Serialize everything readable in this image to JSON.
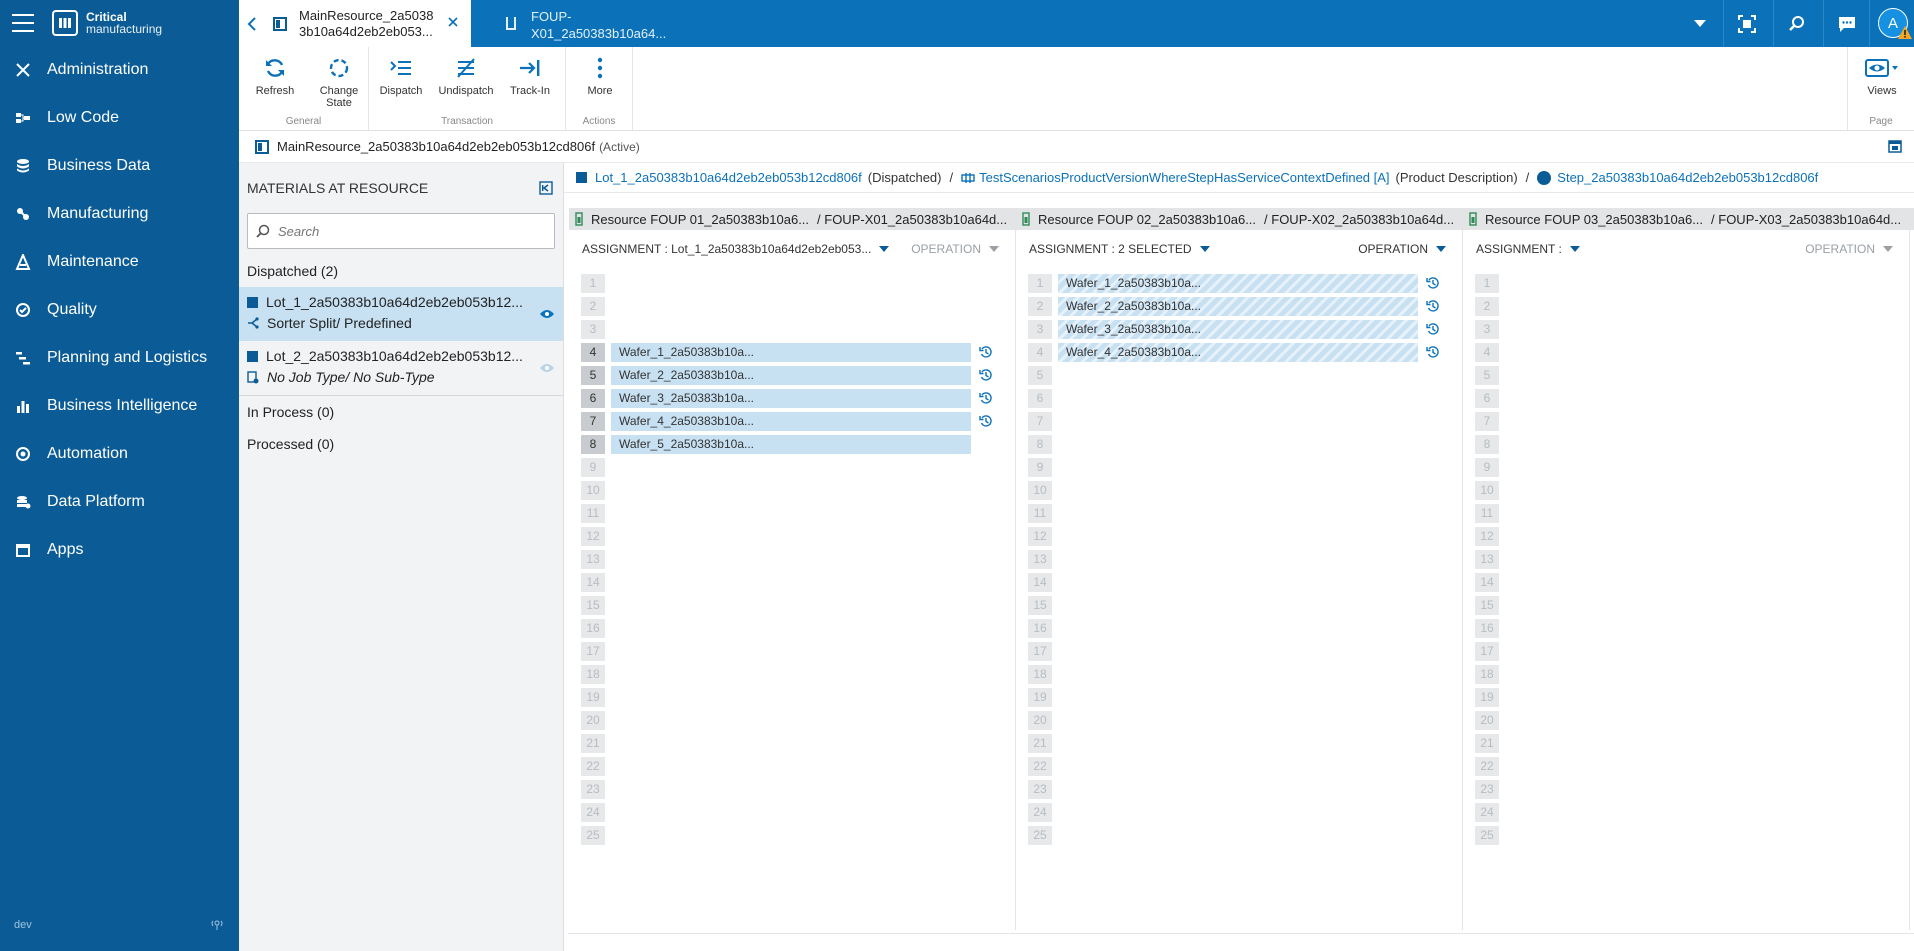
{
  "app": {
    "brand_line1": "Critical",
    "brand_line2": "manufacturing",
    "env": "dev"
  },
  "sidebar": {
    "items": [
      {
        "label": "Administration",
        "icon": "wrench-cross-icon"
      },
      {
        "label": "Low Code",
        "icon": "low-code-icon"
      },
      {
        "label": "Business Data",
        "icon": "database-icon"
      },
      {
        "label": "Manufacturing",
        "icon": "manufacturing-icon"
      },
      {
        "label": "Maintenance",
        "icon": "maintenance-icon"
      },
      {
        "label": "Quality",
        "icon": "quality-icon"
      },
      {
        "label": "Planning and Logistics",
        "icon": "planning-icon"
      },
      {
        "label": "Business Intelligence",
        "icon": "bar-chart-icon"
      },
      {
        "label": "Automation",
        "icon": "automation-icon"
      },
      {
        "label": "Data Platform",
        "icon": "data-platform-icon"
      },
      {
        "label": "Apps",
        "icon": "apps-icon"
      }
    ]
  },
  "tabs": [
    {
      "title": "MainResource_2a50383b10a64d2eb2eb053...",
      "active": true
    },
    {
      "title": "FOUP-X01_2a50383b10a64...",
      "active": false
    }
  ],
  "user": {
    "initial": "A"
  },
  "ribbon": {
    "groups": [
      {
        "label": "General",
        "buttons": [
          "Refresh",
          "Change State"
        ]
      },
      {
        "label": "Transaction",
        "buttons": [
          "Dispatch",
          "Undispatch",
          "Track-In"
        ]
      },
      {
        "label": "Actions",
        "buttons": [
          "More"
        ]
      },
      {
        "label": "Page",
        "buttons": [
          "Views"
        ]
      }
    ]
  },
  "crumb": {
    "title": "MainResource_2a50383b10a64d2eb2eb053b12cd806f",
    "status": "(Active)"
  },
  "left_panel": {
    "title": "MATERIALS AT RESOURCE",
    "search_placeholder": "Search",
    "dispatched_label": "Dispatched (2)",
    "items": [
      {
        "name": "Lot_1_2a50383b10a64d2eb2eb053b12...",
        "subtitle": "Sorter Split/ Predefined"
      },
      {
        "name": "Lot_2_2a50383b10a64d2eb2eb053b12...",
        "subtitle": "No Job Type/ No Sub-Type"
      }
    ],
    "in_process_label": "In Process (0)",
    "processed_label": "Processed (0)"
  },
  "context": {
    "lot": "Lot_1_2a50383b10a64d2eb2eb053b12cd806f",
    "lot_state": "(Dispatched)",
    "product": "TestScenariosProductVersionWhereStepHasServiceContextDefined [A]",
    "product_desc": "(Product Description)",
    "step": "Step_2a50383b10a64d2eb2eb053b12cd806f"
  },
  "resources": [
    {
      "resource": "Resource FOUP 01_2a50383b10a6...",
      "container": "/ FOUP-X01_2a50383b10a64d..."
    },
    {
      "resource": "Resource FOUP 02_2a50383b10a6...",
      "container": "/ FOUP-X02_2a50383b10a64d..."
    },
    {
      "resource": "Resource FOUP 03_2a50383b10a6...",
      "container": "/ FOUP-X03_2a50383b10a64d..."
    }
  ],
  "columns": [
    {
      "assignment": "ASSIGNMENT : Lot_1_2a50383b10a64d2eb2eb053...",
      "operation": "OPERATION",
      "op_dim": true,
      "wafers": [
        {
          "slot": 4,
          "name": "Wafer_1_2a50383b10a..."
        },
        {
          "slot": 5,
          "name": "Wafer_2_2a50383b10a..."
        },
        {
          "slot": 6,
          "name": "Wafer_3_2a50383b10a..."
        },
        {
          "slot": 7,
          "name": "Wafer_4_2a50383b10a..."
        },
        {
          "slot": 8,
          "name": "Wafer_5_2a50383b10a..."
        }
      ],
      "history_slots": [
        4,
        5,
        6,
        7
      ]
    },
    {
      "assignment": "ASSIGNMENT : 2 SELECTED",
      "operation": "OPERATION",
      "op_dim": false,
      "wafers": [
        {
          "slot": 1,
          "name": "Wafer_1_2a50383b10a..."
        },
        {
          "slot": 2,
          "name": "Wafer_2_2a50383b10a..."
        },
        {
          "slot": 3,
          "name": "Wafer_3_2a50383b10a..."
        },
        {
          "slot": 4,
          "name": "Wafer_4_2a50383b10a..."
        }
      ],
      "history_slots": [
        1,
        2,
        3,
        4
      ]
    },
    {
      "assignment": "ASSIGNMENT :",
      "operation": "OPERATION",
      "op_dim": true,
      "wafers": [],
      "history_slots": []
    }
  ],
  "slot_count": 25,
  "colors": {
    "sidebar": "#0b5c96",
    "topbar": "#0b72b9",
    "accent": "#0b72b9",
    "wafer": "#c8e1f2"
  }
}
